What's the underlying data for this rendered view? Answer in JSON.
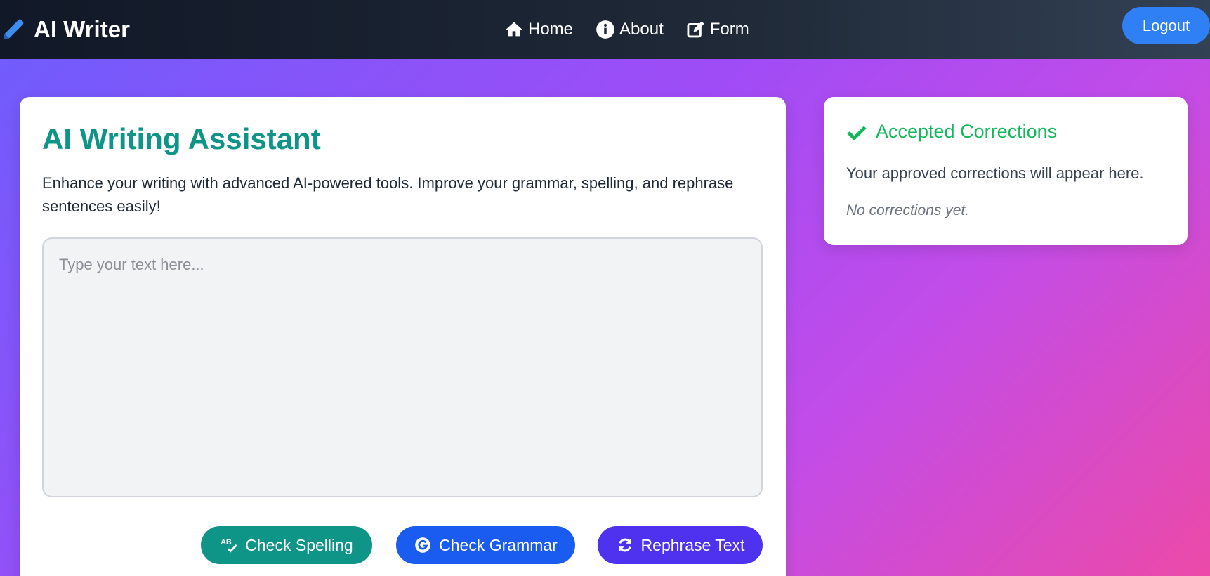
{
  "nav": {
    "brand": "AI Writer",
    "links": [
      {
        "label": "Home",
        "icon": "home-icon"
      },
      {
        "label": "About",
        "icon": "info-icon"
      },
      {
        "label": "Form",
        "icon": "edit-icon"
      }
    ],
    "logout_label": "Logout"
  },
  "main": {
    "title": "AI Writing Assistant",
    "description": "Enhance your writing with advanced AI-powered tools. Improve your grammar, spelling, and rephrase sentences easily!",
    "editor": {
      "value": "",
      "placeholder": "Type your text here..."
    },
    "buttons": {
      "spelling": "Check Spelling",
      "grammar": "Check Grammar",
      "rephrase": "Rephrase Text"
    }
  },
  "corrections": {
    "title": "Accepted Corrections",
    "description": "Your approved corrections will appear here.",
    "empty": "No corrections yet."
  },
  "colors": {
    "accent_teal": "#0f9488",
    "accent_blue": "#1a5cf0",
    "accent_indigo": "#4f31f0",
    "logout_blue": "#2f80f5",
    "success_green": "#12b85a",
    "nav_dark": "#111827"
  }
}
